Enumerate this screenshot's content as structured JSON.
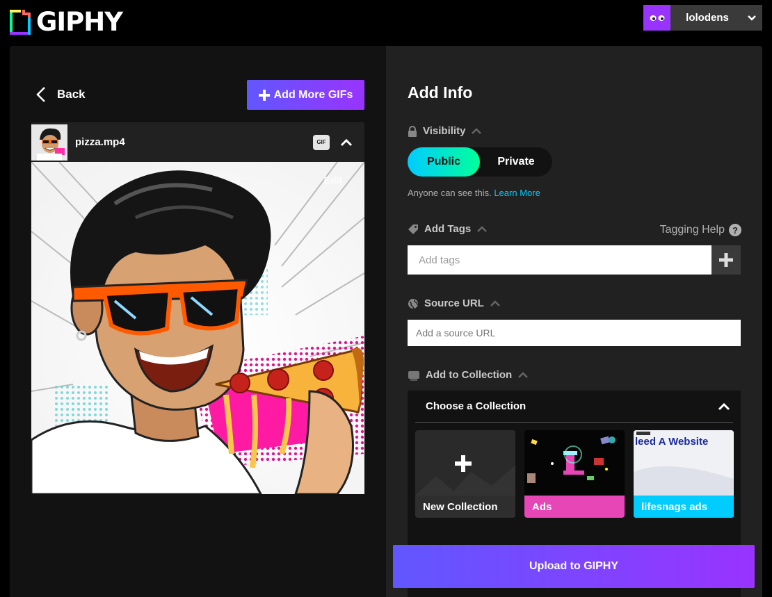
{
  "brand": {
    "name": "GIPHY"
  },
  "user": {
    "name": "lolodens"
  },
  "left": {
    "back_label": "Back",
    "add_more_label": "Add More GIFs",
    "file_name": "pizza.mp4",
    "gif_badge": "GIF",
    "edit_label": "Edit"
  },
  "right": {
    "title": "Add Info",
    "visibility": {
      "label": "Visibility",
      "public_label": "Public",
      "private_label": "Private",
      "selected": "Public",
      "note": "Anyone can see this.",
      "learn_more": "Learn More"
    },
    "tags": {
      "label": "Add Tags",
      "help_label": "Tagging Help",
      "placeholder": "Add tags"
    },
    "source": {
      "label": "Source URL",
      "placeholder": "Add a source URL"
    },
    "collection": {
      "label": "Add to Collection",
      "header": "Choose a Collection",
      "tiles": [
        {
          "label": "New Collection",
          "color": "#2e2e2e"
        },
        {
          "label": "Ads",
          "color": "#e646b6"
        },
        {
          "label": "lifesnags ads",
          "color": "#00ccff",
          "banner_text": "leed A Website"
        }
      ]
    },
    "upload_label": "Upload to GIPHY"
  },
  "colors": {
    "accent_purple": "#9933ff",
    "accent_blue": "#6157ff",
    "accent_cyan": "#00ccff",
    "accent_green": "#00ff99",
    "accent_pink": "#e646b6"
  }
}
